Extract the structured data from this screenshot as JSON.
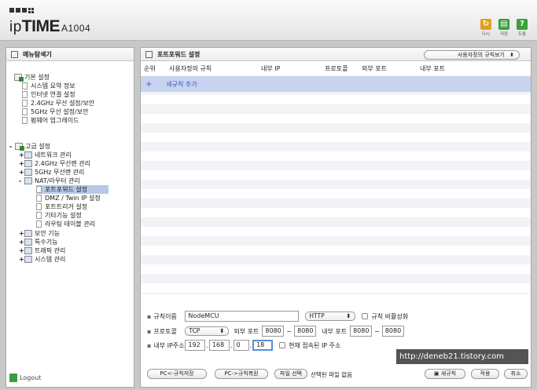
{
  "header": {
    "brand_ip": "ip",
    "brand_time": "TIME",
    "brand_model": "A1004",
    "icons": [
      {
        "name": "refresh-icon",
        "label": "다시",
        "color": "#e0a020"
      },
      {
        "name": "save-icon",
        "label": "저장",
        "color": "#3aa13a"
      },
      {
        "name": "help-icon",
        "label": "도움",
        "color": "#3aa13a"
      }
    ]
  },
  "sidebar": {
    "title": "메뉴탐색기",
    "basic": {
      "label": "기본 설정",
      "items": [
        "시스템 요약 정보",
        "인터넷 연결 설정",
        "2.4GHz 무선 설정/보안",
        "5GHz 무선 설정/보안",
        "펌웨어 업그레이드"
      ]
    },
    "advanced": {
      "label": "고급 설정",
      "items": [
        "네트워크 관리",
        "2.4GHz 무선랜 관리",
        "5GHz 무선랜 관리",
        "NAT/라우터 관리"
      ],
      "nat_items": [
        "포트포워드 설정",
        "DMZ / Twin IP 설정",
        "포트트리거 설정",
        "기타기능 설정",
        "라우팅 테이블 관리"
      ],
      "more_items": [
        "보안 기능",
        "특수기능",
        "트래픽 관리",
        "시스템 관리"
      ]
    },
    "logout": "Logout"
  },
  "main": {
    "title": "포트포워드 설정",
    "view_select": "사용자정의 규칙보기",
    "columns": [
      "순위",
      "사용자정의 규칙",
      "내부 IP",
      "프로토콜",
      "외부 포트",
      "내부 포트"
    ],
    "add_rule": "새규칙 추가",
    "form": {
      "rule_name_label": "규칙이름",
      "rule_name_value": "NodeMCU",
      "service_select": "HTTP",
      "disable_label": "규칙 비활성화",
      "protocol_label": "프로토콜",
      "protocol_value": "TCP",
      "ext_port_label": "외부 포트",
      "ext_port_from": "8080",
      "ext_port_to": "8080",
      "int_port_label": "내부 포트",
      "int_port_from": "8080",
      "int_port_to": "8080",
      "tilde": "~",
      "ip_label": "내부 IP주소",
      "ip": [
        "192",
        "168",
        "0",
        "18"
      ],
      "current_ip_label": "현재 접속된 IP 주소"
    },
    "buttons": {
      "pc_save": "PC<-규칙저장",
      "pc_restore": "PC->규칙복원",
      "file_select": "파일 선택",
      "no_file": "선택된 파일 없음",
      "new_rule": "새규칙",
      "apply": "적용",
      "cancel": "취소"
    },
    "watermark": "http://deneb21.tistory.com"
  }
}
